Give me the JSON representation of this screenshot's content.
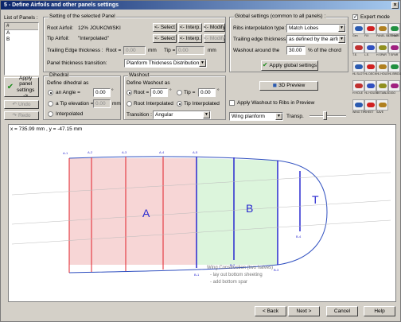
{
  "window": {
    "title": "5 - Define Airfoils and other panels settings",
    "close_label": "×"
  },
  "panels_list": {
    "title": "List of Panels :",
    "header": "#",
    "items": [
      "A",
      "B"
    ],
    "apply_label": "Apply panel settings ->",
    "undo_label": "Undo",
    "redo_label": "Redo"
  },
  "selected_panel": {
    "group_title": "Setting of the selected Panel",
    "root_airfoil_label": "Root Airfoil:",
    "root_airfoil_value": "12% JOUKOWSKI",
    "tip_airfoil_label": "Tip Airfoil:",
    "tip_airfoil_value": "\"Interpolated\"",
    "select_label": "<- Select",
    "interp_label": "<- Interp.",
    "modify_label": "<- Modify",
    "te_thickness_label": "Trailing Edge thickness :",
    "root_label": "Root =",
    "tip_label": "Tip =",
    "root_te_value": "0.00",
    "tip_te_value": "0.00",
    "mm_unit": "mm",
    "transition_label": "Panel thickness transition:",
    "transition_value": "Planform Thickness Distribution"
  },
  "dihedral": {
    "title": "Dihedral",
    "define_label": "Define dihedral as",
    "angle_label": "an Angle =",
    "angle_value": "0.00",
    "deg_unit": "°",
    "tip_elev_label": "a Tip elevation =",
    "tip_elev_value": "0.00",
    "mm_unit": "mm",
    "interp_label": "Interpolated"
  },
  "washout": {
    "title": "Washout",
    "define_label": "Define Washout as",
    "root_label": "Root =",
    "root_value": "0.00",
    "tip_label": "Tip =",
    "tip_value": "0.00",
    "deg_unit": "°",
    "root_interp_label": "Root Interpolated",
    "tip_interp_label": "Tip Interpolated",
    "transition_label": "Transition :",
    "transition_value": "Angular"
  },
  "global": {
    "title": "Global settings (common to all panels) :",
    "ribs_interp_label": "Ribs interpolation type:",
    "ribs_interp_value": "Match Lobes",
    "te_thick_label": "Trailing edge thickness:",
    "te_thick_value": "as defined by the airfoil",
    "washout_label": "Washout around the",
    "washout_value": "30.00",
    "washout_suffix": "% of the chord",
    "apply_label": "Apply global settings"
  },
  "preview": {
    "button_label": "3D Preview",
    "apply_washout_label": "Apply Washout to Ribs in Preview",
    "view_value": "Wing planform",
    "transp_label": "Transp."
  },
  "expert": {
    "label": "Expert mode",
    "checked": true
  },
  "tools": [
    {
      "icon": "gen-icon",
      "label": "Gen"
    },
    {
      "icon": "fix-icon",
      "label": "FIX"
    },
    {
      "icon": "panel-setting-icon",
      "label": "PANEL SETTING"
    },
    {
      "icon": "l-shape-icon",
      "label": "L SHAPE"
    },
    {
      "icon": "te-icon",
      "label": "T.E."
    },
    {
      "icon": "le-icon",
      "label": "L.E."
    },
    {
      "icon": "hspar-icon",
      "label": "H SPAR"
    },
    {
      "icon": "tspar-icon",
      "label": "T SPAR"
    },
    {
      "icon": "hl-slot-icon",
      "label": "HL SLOT"
    },
    {
      "icon": "hl-deck-icon",
      "label": "HL DECK"
    },
    {
      "icon": "hl-hole-icon",
      "label": "HL HOLE"
    },
    {
      "icon": "hl-bridge-icon",
      "label": "HL BRIDGE"
    },
    {
      "icon": "h-hole-icon",
      "label": "H HOLE"
    },
    {
      "icon": "hl-holes-icon",
      "label": "HL HOLES"
    },
    {
      "icon": "retable-icon",
      "label": "RETABLE"
    },
    {
      "icon": "gigo-icon",
      "label": "GIGO"
    },
    {
      "icon": "wing-tip-icon",
      "label": "WING TIP"
    },
    {
      "icon": "sheet-icon",
      "label": "SHEET"
    },
    {
      "icon": "save-icon",
      "label": "SAVE"
    }
  ],
  "canvas": {
    "coords": "x = 735.99 mm , y = -47.15 mm",
    "panel_a": "A",
    "panel_b": "B",
    "panel_t": "T",
    "rib_labels": [
      "A-1",
      "A-2",
      "A-3",
      "A-4",
      "A-5",
      "B-2",
      "B-3",
      "B-4"
    ],
    "bottom_rib_labels": [
      "B-1",
      "B-2",
      "B-3",
      "B-4"
    ],
    "notes": [
      "Wing Construction (two halves)",
      "- lay out bottom sheeting",
      "- add bottom spar"
    ]
  },
  "footer": {
    "back": "< Back",
    "next": "Next >",
    "cancel": "Cancel",
    "help": "Help"
  },
  "colors": {
    "panel_a": "#f7d6d6",
    "panel_b": "#dcf5dc",
    "rib_a": "#e0202a",
    "rib_b": "#2a2ad0",
    "title_start": "#0a246a"
  }
}
